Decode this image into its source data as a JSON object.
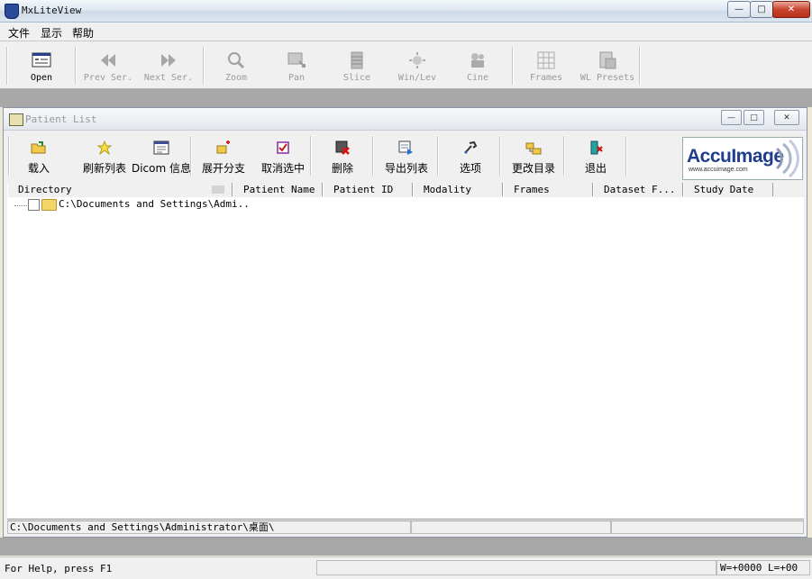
{
  "window": {
    "title": "MxLiteView"
  },
  "menu": [
    "文件",
    "显示",
    "帮助"
  ],
  "toolbar": [
    {
      "label": "Open",
      "icon": "open-icon",
      "enabled": true
    },
    {
      "label": "Prev Ser.",
      "icon": "prev-series-icon",
      "enabled": false
    },
    {
      "label": "Next Ser.",
      "icon": "next-series-icon",
      "enabled": false
    },
    {
      "label": "Zoom",
      "icon": "zoom-icon",
      "enabled": false
    },
    {
      "label": "Pan",
      "icon": "pan-icon",
      "enabled": false
    },
    {
      "label": "Slice",
      "icon": "slice-icon",
      "enabled": false
    },
    {
      "label": "Win/Lev",
      "icon": "window-level-icon",
      "enabled": false
    },
    {
      "label": "Cine",
      "icon": "cine-icon",
      "enabled": false
    },
    {
      "label": "Frames",
      "icon": "frames-icon",
      "enabled": false
    },
    {
      "label": "WL Presets",
      "icon": "wl-presets-icon",
      "enabled": false
    }
  ],
  "patient_list": {
    "title": "Patient List",
    "toolbar": [
      {
        "label": "载入",
        "icon": "load-icon"
      },
      {
        "label": "刷新列表",
        "icon": "refresh-icon"
      },
      {
        "label": "Dicom 信息",
        "icon": "dicom-info-icon"
      },
      {
        "label": "展开分支",
        "icon": "expand-branch-icon"
      },
      {
        "label": "取消选中",
        "icon": "uncheck-icon"
      },
      {
        "label": "删除",
        "icon": "delete-icon"
      },
      {
        "label": "导出列表",
        "icon": "export-list-icon"
      },
      {
        "label": "选项",
        "icon": "options-icon"
      },
      {
        "label": "更改目录",
        "icon": "change-directory-icon"
      },
      {
        "label": "退出",
        "icon": "exit-icon"
      }
    ],
    "logo": {
      "text": "AccuImage",
      "sub": "www.accuimage.com"
    },
    "columns": [
      "Directory",
      "Patient Name",
      "Patient ID",
      "Modality",
      "Frames",
      "Dataset F...",
      "Study Date"
    ],
    "tree": [
      {
        "label": "C:\\Documents and Settings\\Admi..",
        "checked": false
      }
    ],
    "path": "C:\\Documents and Settings\\Administrator\\桌面\\"
  },
  "status": {
    "help": "For Help, press F1",
    "wl": "W=+0000  L=+00"
  },
  "colors": {
    "accent_blue": "#1f3d8c",
    "folder": "#f4d66b",
    "disabled_text": "#9a9a9a"
  }
}
